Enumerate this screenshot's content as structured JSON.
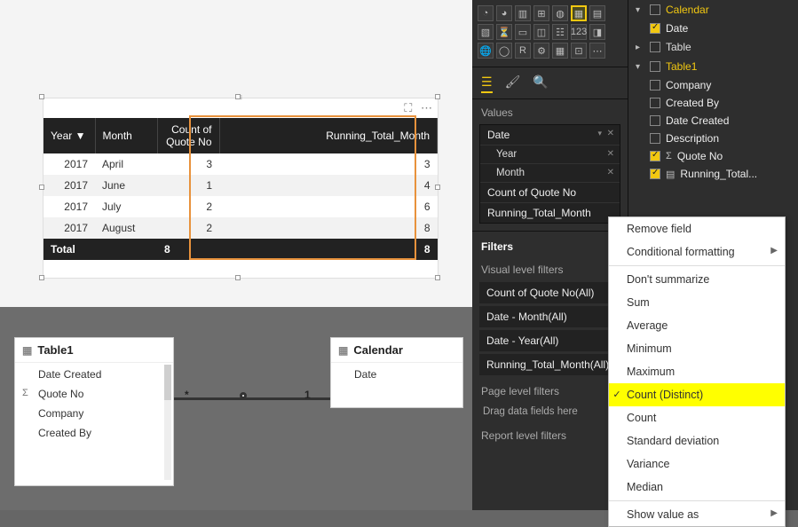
{
  "visual": {
    "headers": [
      "Year ▼",
      "Month",
      "Count of Quote No",
      "Running_Total_Month"
    ],
    "rows": [
      {
        "year": "2017",
        "month": "April",
        "count": "3",
        "run": "3"
      },
      {
        "year": "2017",
        "month": "June",
        "count": "1",
        "run": "4"
      },
      {
        "year": "2017",
        "month": "July",
        "count": "2",
        "run": "6"
      },
      {
        "year": "2017",
        "month": "August",
        "count": "2",
        "run": "8"
      }
    ],
    "total_label": "Total",
    "total_count": "8",
    "total_run": "8"
  },
  "model": {
    "entity1": {
      "name": "Table1",
      "fields": [
        "Date Created",
        "Quote No",
        "Company",
        "Created By"
      ]
    },
    "entity2": {
      "name": "Calendar",
      "fields": [
        "Date"
      ]
    },
    "card_star": "*",
    "card_one": "1"
  },
  "vizpane": {
    "values_label": "Values",
    "well": [
      {
        "label": "Date"
      },
      {
        "label": "Year",
        "sub": true
      },
      {
        "label": "Month",
        "sub": true
      },
      {
        "label": "Count of Quote No"
      },
      {
        "label": "Running_Total_Month"
      }
    ],
    "filters_label": "Filters",
    "vlf_label": "Visual level filters",
    "filters": [
      "Count of Quote No(All)",
      "Date - Month(All)",
      "Date - Year(All)",
      "Running_Total_Month(All)"
    ],
    "plf_label": "Page level filters",
    "drag_hint": "Drag data fields here",
    "rlf_label": "Report level filters"
  },
  "fields": {
    "table_calendar": "Calendar",
    "f_date": "Date",
    "table_table": "Table",
    "table_table1": "Table1",
    "f_company": "Company",
    "f_createdby": "Created By",
    "f_datecreated": "Date Created",
    "f_description": "Description",
    "f_quoteno": "Quote No",
    "f_running": "Running_Total..."
  },
  "ctx": {
    "remove": "Remove field",
    "cond": "Conditional formatting",
    "dont": "Don't summarize",
    "sum": "Sum",
    "avg": "Average",
    "min": "Minimum",
    "max": "Maximum",
    "cdist": "Count (Distinct)",
    "count": "Count",
    "std": "Standard deviation",
    "var": "Variance",
    "med": "Median",
    "show": "Show value as"
  },
  "chart_data": {
    "type": "table",
    "title": "",
    "columns": [
      "Year",
      "Month",
      "Count of Quote No",
      "Running_Total_Month"
    ],
    "rows": [
      [
        2017,
        "April",
        3,
        3
      ],
      [
        2017,
        "June",
        1,
        4
      ],
      [
        2017,
        "July",
        2,
        6
      ],
      [
        2017,
        "August",
        2,
        8
      ]
    ],
    "totals": {
      "Count of Quote No": 8,
      "Running_Total_Month": 8
    }
  }
}
